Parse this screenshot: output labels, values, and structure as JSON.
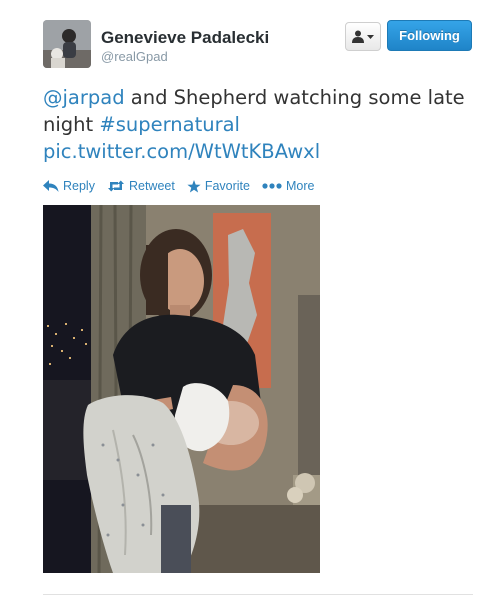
{
  "user": {
    "display_name": "Genevieve Padalecki",
    "handle": "@realGpad",
    "avatar_icon": "user-avatar-photo"
  },
  "header_actions": {
    "user_dropdown_icon": "person-icon",
    "follow_label": "Following",
    "follow_color": "#2a95d8"
  },
  "tweet": {
    "mention": "@jarpad",
    "text_part_1": " and Shepherd watching some late night ",
    "hashtag": "#supernatural",
    "media_link": "pic.twitter.com/WtWtKBAwxl",
    "link_color": "#2f83bd"
  },
  "actions": {
    "reply": "Reply",
    "retweet": "Retweet",
    "favorite": "Favorite",
    "more": "More"
  }
}
